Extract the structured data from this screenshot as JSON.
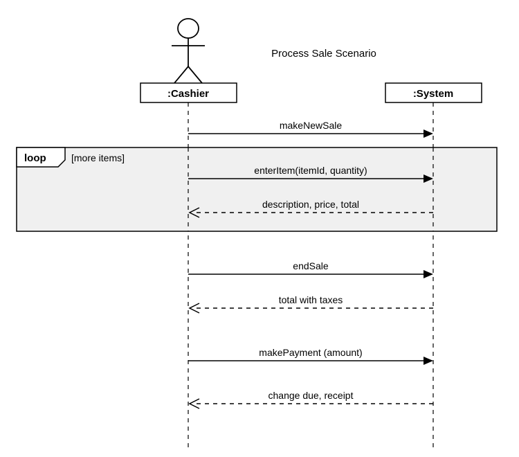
{
  "title": "Process Sale Scenario",
  "participants": {
    "cashier": ":Cashier",
    "system": ":System"
  },
  "fragment": {
    "type": "loop",
    "guard": "[more items]"
  },
  "messages": {
    "m1": "makeNewSale",
    "m2": "enterItem(itemId, quantity)",
    "m3": "description, price, total",
    "m4": "endSale",
    "m5": "total with taxes",
    "m6": "makePayment (amount)",
    "m7": "change due, receipt"
  }
}
